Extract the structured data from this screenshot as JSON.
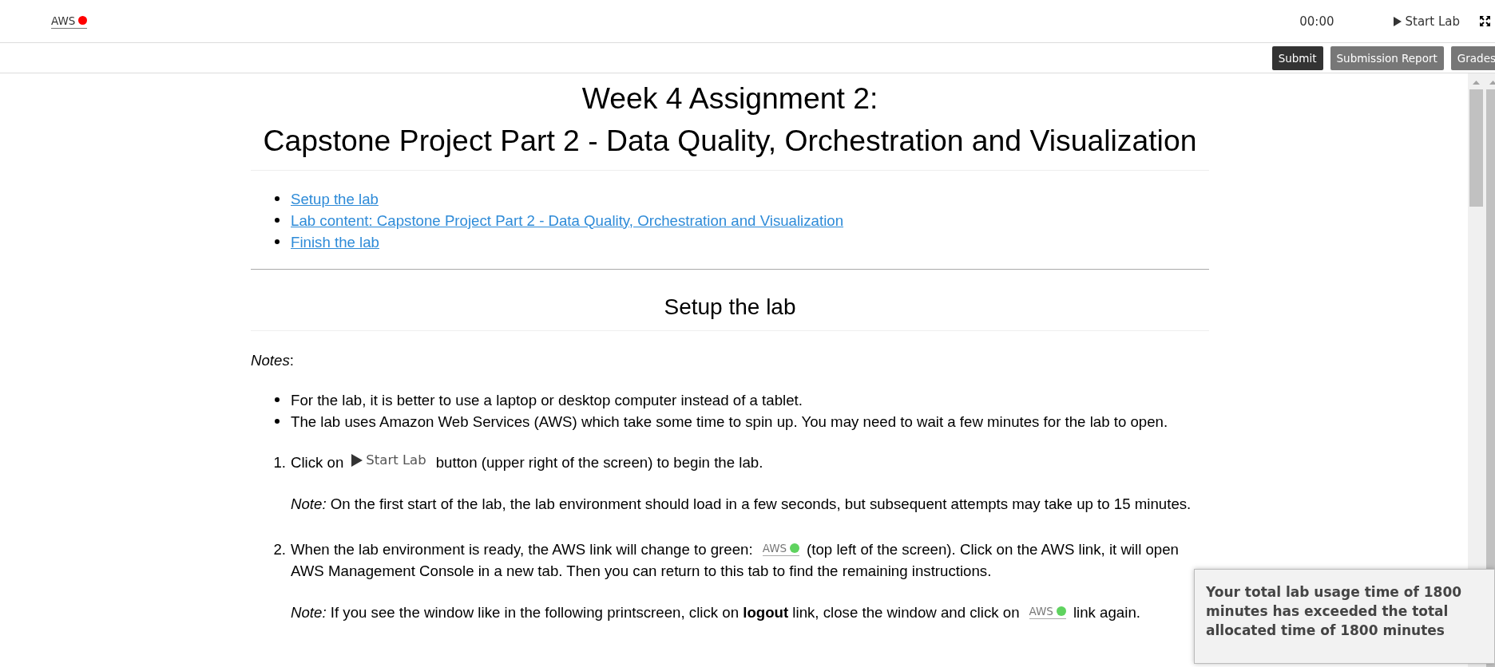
{
  "top_bar": {
    "aws_link": {
      "label": "AWS",
      "ready": false
    },
    "timer": "00:00",
    "start_lab": {
      "label": "Start Lab"
    }
  },
  "action_bar": {
    "buttons": [
      {
        "label": "Submit",
        "kind": "primary"
      },
      {
        "label": "Submission Report",
        "kind": "secondary"
      },
      {
        "label": "Grades",
        "kind": "secondary"
      }
    ]
  },
  "document": {
    "title_lines": [
      "Week 4 Assignment 2:",
      "Capstone Project Part 2 - Data Quality, Orchestration and Visualization"
    ],
    "toc": [
      "Setup the lab",
      "Lab content: Capstone Project Part 2 - Data Quality, Orchestration and Visualization",
      "Finish the lab"
    ],
    "section": {
      "heading": "Setup the lab",
      "notes_label": "*Notes*:",
      "bullets": [
        "For the lab, it is better to use a laptop or desktop computer instead of a tablet.",
        "The lab uses Amazon Web Services (AWS) which take some time to spin up. You may need to wait a few minutes for the lab to open."
      ],
      "steps": [
        {
          "number": "1.",
          "parts": [
            {
              "kind": "text",
              "text": "Click on"
            },
            {
              "kind": "start_lab",
              "label": "Start Lab"
            },
            {
              "kind": "text",
              "text": "button (upper right of the screen) to begin the lab."
            }
          ],
          "note_parts": [
            {
              "kind": "text",
              "text": "*Note:* On the first start of the lab, the lab environment should load in a few seconds, but subsequent attempts may take up to 15 minutes."
            }
          ]
        },
        {
          "number": "2.",
          "parts": [
            {
              "kind": "text",
              "text": "When the lab environment is ready, the AWS link will change to green:"
            },
            {
              "kind": "aws",
              "label": "AWS",
              "ready": true
            },
            {
              "kind": "text",
              "text": "(top left of the screen). Click on the AWS link, it will open AWS Management Console in a new tab. Then you can return to this tab to find the remaining instructions."
            }
          ],
          "note_parts": [
            {
              "kind": "text",
              "text": "*Note:* If you see the window like in the following printscreen, click on **logout** link, close the window and click on"
            },
            {
              "kind": "aws",
              "label": "AWS",
              "ready": true
            },
            {
              "kind": "text",
              "text": "link again."
            }
          ]
        }
      ]
    }
  },
  "notification": {
    "message": "Your total lab usage time of 1800 minutes has exceeded the total allocated time of 1800 minutes"
  }
}
